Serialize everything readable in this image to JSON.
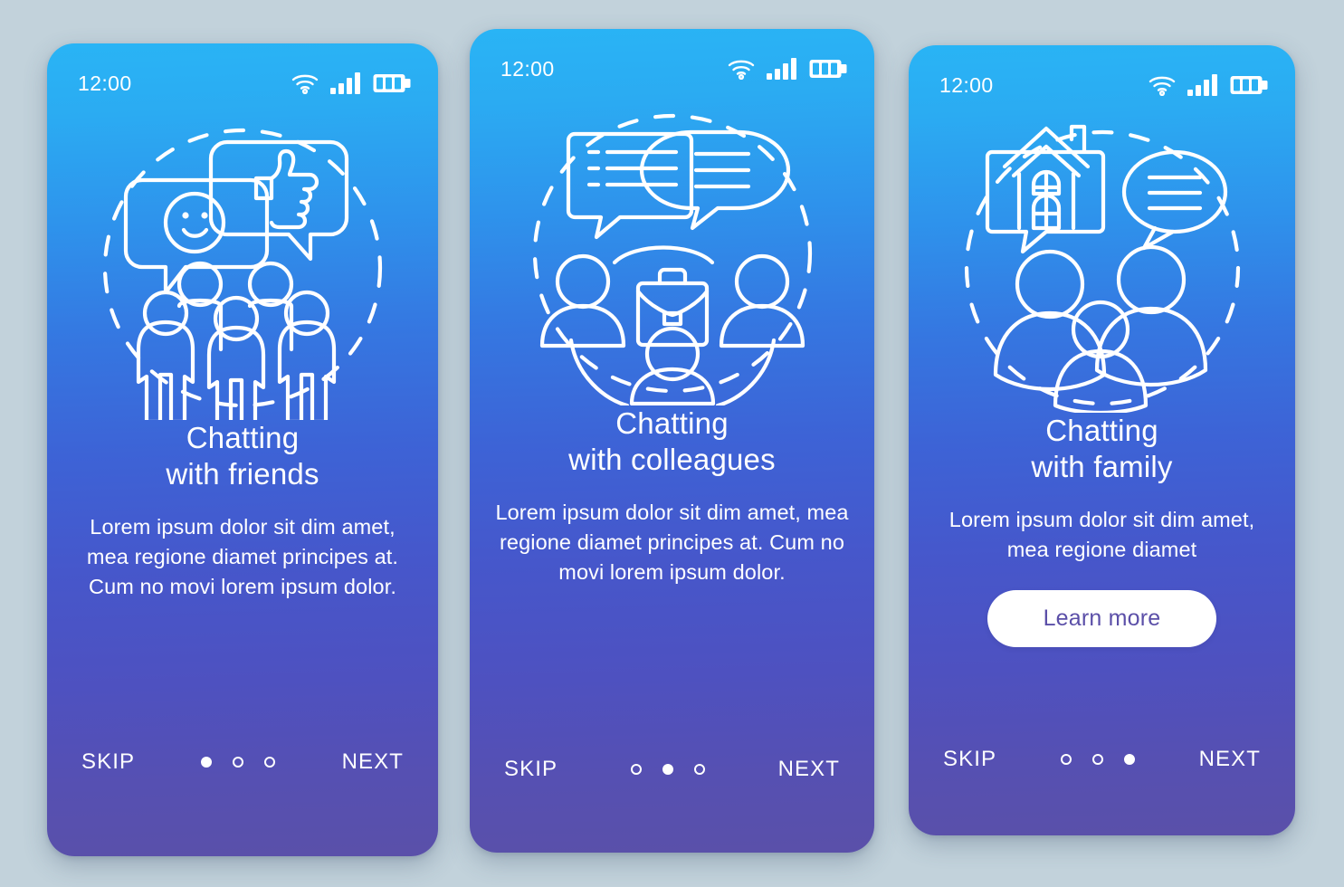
{
  "background_color": "#c2d2db",
  "theme": {
    "gradient_top": "#29b4f5",
    "gradient_mid": "#3d63d6",
    "gradient_bottom": "#5a50a9",
    "text_color": "#ffffff",
    "cta_bg": "#ffffff",
    "cta_text_color": "#5b4fa8"
  },
  "screens": [
    {
      "id": "chatting-with-friends",
      "status": {
        "time": "12:00",
        "icons": [
          "wifi-icon",
          "signal-icon",
          "battery-icon"
        ]
      },
      "illustration": {
        "name": "friends-group-illustration",
        "elements": [
          "dashed-circle",
          "smiley-speech-bubble",
          "thumbs-up-speech-bubble",
          "group-of-people"
        ]
      },
      "title_line_1": "Chatting",
      "title_line_2": "with friends",
      "body": "Lorem ipsum dolor sit dim amet, mea regione diamet principes at. Cum no movi lorem ipsum dolor.",
      "cta": null,
      "footer": {
        "skip_label": "SKIP",
        "next_label": "NEXT",
        "dots": [
          true,
          false,
          false
        ]
      }
    },
    {
      "id": "chatting-with-colleagues",
      "status": {
        "time": "12:00",
        "icons": [
          "wifi-icon",
          "signal-icon",
          "battery-icon"
        ]
      },
      "illustration": {
        "name": "colleagues-team-illustration",
        "elements": [
          "dashed-circle",
          "message-list-bubble",
          "round-speech-bubble",
          "briefcase-icon",
          "three-avatars"
        ]
      },
      "title_line_1": "Chatting",
      "title_line_2": "with colleagues",
      "body": "Lorem ipsum dolor sit dim amet, mea regione diamet principes at. Cum no movi lorem ipsum dolor.",
      "cta": null,
      "footer": {
        "skip_label": "SKIP",
        "next_label": "NEXT",
        "dots": [
          false,
          true,
          false
        ]
      }
    },
    {
      "id": "chatting-with-family",
      "status": {
        "time": "12:00",
        "icons": [
          "wifi-icon",
          "signal-icon",
          "battery-icon"
        ]
      },
      "illustration": {
        "name": "family-home-illustration",
        "elements": [
          "dashed-circle",
          "house-speech-bubble",
          "lines-speech-bubble",
          "family-of-three"
        ]
      },
      "title_line_1": "Chatting",
      "title_line_2": "with family",
      "body": "Lorem ipsum dolor sit dim amet, mea regione diamet",
      "cta": "Learn more",
      "footer": {
        "skip_label": "SKIP",
        "next_label": "NEXT",
        "dots": [
          false,
          false,
          true
        ]
      }
    }
  ]
}
